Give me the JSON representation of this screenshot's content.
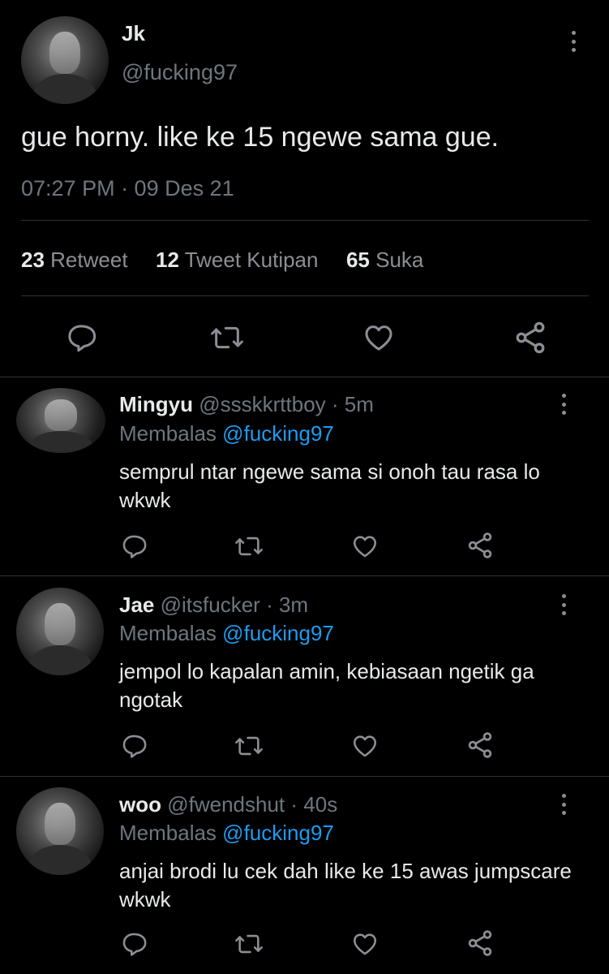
{
  "main_tweet": {
    "author_name": "Jk",
    "handle": "@fucking97",
    "text": "gue horny. like ke 15 ngewe sama gue.",
    "timestamp": "07:27 PM · 09 Des 21",
    "stats": {
      "retweets_count": "23",
      "retweets_label": "Retweet",
      "quotes_count": "12",
      "quotes_label": "Tweet Kutipan",
      "likes_count": "65",
      "likes_label": "Suka"
    }
  },
  "replies": [
    {
      "name": "Mingyu",
      "handle": "@ssskkrttboy",
      "time": "· 5m",
      "replying_label": "Membalas",
      "replying_to": "@fucking97",
      "text": "semprul ntar ngewe sama si onoh tau rasa lo wkwk"
    },
    {
      "name": "Jae",
      "handle": "@itsfucker",
      "time": "· 3m",
      "replying_label": "Membalas",
      "replying_to": "@fucking97",
      "text": "jempol lo kapalan amin, kebiasaan ngetik ga ngotak"
    },
    {
      "name": "woo",
      "handle": "@fwendshut",
      "time": "· 40s",
      "replying_label": "Membalas",
      "replying_to": "@fucking97",
      "text": "anjai brodi lu cek dah like ke 15 awas jumpscare wkwk"
    }
  ],
  "theme": {
    "background": "#000000",
    "accent": "#1d9bf0",
    "muted_text": "#6e767d",
    "divider": "#2f3336"
  },
  "icons": [
    "reply-icon",
    "retweet-icon",
    "like-icon",
    "share-icon",
    "more-options-icon"
  ]
}
